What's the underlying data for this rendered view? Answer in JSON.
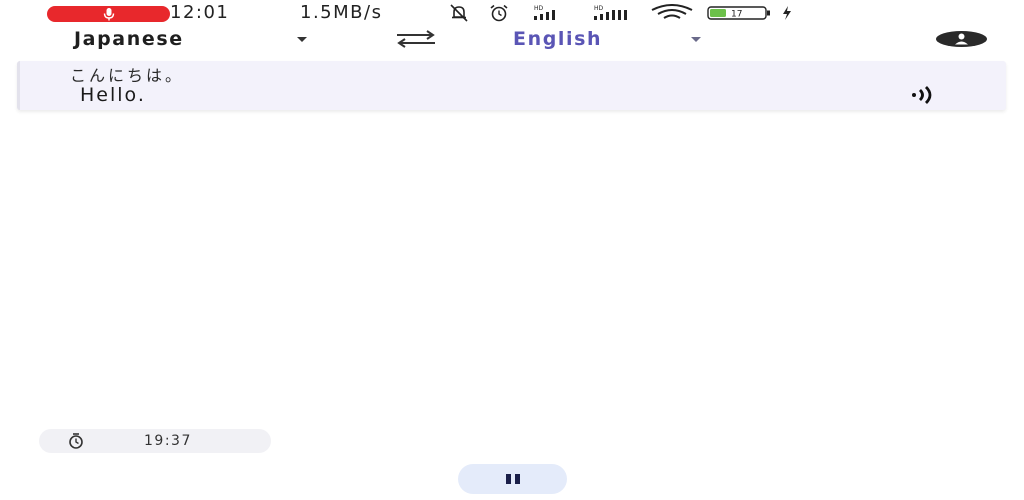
{
  "status_bar": {
    "recording_indicator": "microphone-icon",
    "time": "12:01",
    "network_speed": "1.5MB/s",
    "icons": [
      "muted-bell-icon",
      "alarm-icon",
      "cell-signal-icon",
      "cell-signal-icon",
      "wifi-icon",
      "battery-icon",
      "charging-icon"
    ],
    "battery_level": "17",
    "rec_color": "#e8282c"
  },
  "header": {
    "source_language": "Japanese",
    "target_language": "English",
    "swap_icon": "swap-arrows-icon",
    "account_icon": "account-icon",
    "accent_color": "#5a55b5"
  },
  "transcript": {
    "original": "こんにちは。",
    "translation": "Hello.",
    "speaker_icon": "speaker-icon"
  },
  "timer": {
    "icon": "timer-icon",
    "elapsed": "19:37"
  },
  "controls": {
    "pause_icon": "pause-icon"
  }
}
